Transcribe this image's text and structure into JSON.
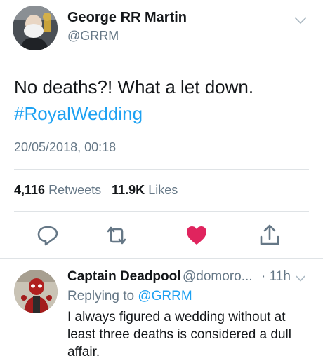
{
  "tweet": {
    "author_name": "George RR Martin",
    "author_handle": "@GRRM",
    "text_main": "No deaths?! What a let down.",
    "hashtag": "#RoyalWedding",
    "timestamp": "20/05/2018, 00:18",
    "retweets_count": "4,116",
    "retweets_label": "Retweets",
    "likes_count": "11.9K",
    "likes_label": "Likes",
    "liked": true,
    "colors": {
      "link": "#1da1f2",
      "like": "#e0245e",
      "muted": "#657786"
    }
  },
  "actions": {
    "reply_icon": "reply-icon",
    "retweet_icon": "retweet-icon",
    "like_icon": "heart-icon",
    "share_icon": "share-icon"
  },
  "reply": {
    "author_name": "Captain Deadpool",
    "author_handle": "@domoro...",
    "time": "· 11h",
    "replying_prefix": "Replying to",
    "replying_to": "@GRRM",
    "text": "I always figured a wedding without at least three deaths is considered a dull affair."
  }
}
